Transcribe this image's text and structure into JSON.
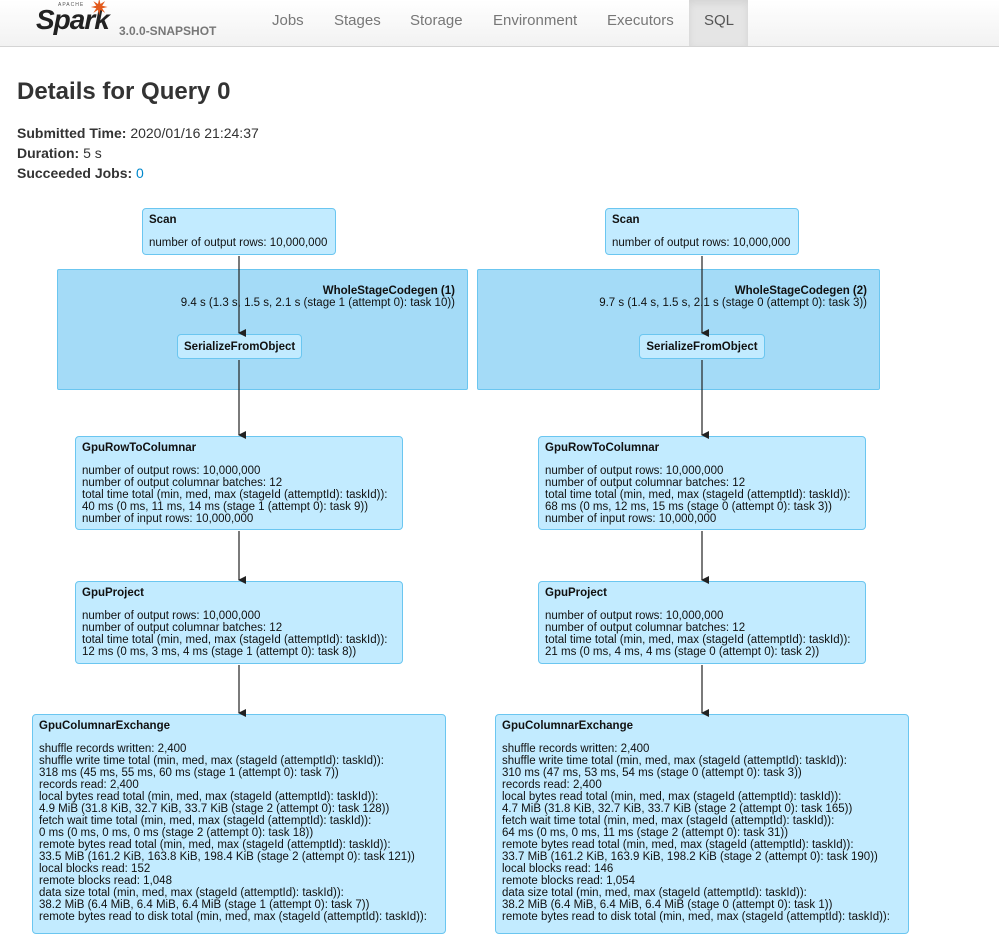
{
  "navbar": {
    "brand_apache": "APACHE",
    "brand_name": "Spark",
    "version": "3.0.0-SNAPSHOT",
    "tabs": [
      {
        "label": "Jobs"
      },
      {
        "label": "Stages"
      },
      {
        "label": "Storage"
      },
      {
        "label": "Environment"
      },
      {
        "label": "Executors"
      },
      {
        "label": "SQL",
        "active": true
      }
    ]
  },
  "page": {
    "title": "Details for Query 0",
    "submitted_label": "Submitted Time:",
    "submitted_value": "2020/01/16 21:24:37",
    "duration_label": "Duration:",
    "duration_value": "5 s",
    "jobs_label": "Succeeded Jobs:",
    "jobs_value": "0"
  },
  "colors": {
    "cluster_fill": "#a4dbf7",
    "node_fill": "#c2ebff",
    "node_border": "#6bc6f0",
    "accent_star": "#e25a1c",
    "link": "#0088cc"
  },
  "plan": {
    "left": {
      "scan": {
        "title": "Scan",
        "metrics": [
          "number of output rows: 10,000,000"
        ]
      },
      "codegen": {
        "title": "WholeStageCodegen (1)",
        "metric": "9.4 s (1.3 s, 1.5 s, 2.1 s (stage 1 (attempt 0): task 10))"
      },
      "serialize": {
        "title": "SerializeFromObject"
      },
      "row_to_columnar": {
        "title": "GpuRowToColumnar",
        "metrics": [
          "number of output rows: 10,000,000",
          "number of output columnar batches: 12",
          "total time total (min, med, max (stageId (attemptId): taskId)):",
          "40 ms (0 ms, 11 ms, 14 ms (stage 1 (attempt 0): task 9))",
          "number of input rows: 10,000,000"
        ]
      },
      "project": {
        "title": "GpuProject",
        "metrics": [
          "number of output rows: 10,000,000",
          "number of output columnar batches: 12",
          "total time total (min, med, max (stageId (attemptId): taskId)):",
          "12 ms (0 ms, 3 ms, 4 ms (stage 1 (attempt 0): task 8))"
        ]
      },
      "exchange": {
        "title": "GpuColumnarExchange",
        "metrics": [
          "shuffle records written: 2,400",
          "shuffle write time total (min, med, max (stageId (attemptId): taskId)):",
          "318 ms (45 ms, 55 ms, 60 ms (stage 1 (attempt 0): task 7))",
          "records read: 2,400",
          "local bytes read total (min, med, max (stageId (attemptId): taskId)):",
          "4.9 MiB (31.8 KiB, 32.7 KiB, 33.7 KiB (stage 2 (attempt 0): task 128))",
          "fetch wait time total (min, med, max (stageId (attemptId): taskId)):",
          "0 ms (0 ms, 0 ms, 0 ms (stage 2 (attempt 0): task 18))",
          "remote bytes read total (min, med, max (stageId (attemptId): taskId)):",
          "33.5 MiB (161.2 KiB, 163.8 KiB, 198.4 KiB (stage 2 (attempt 0): task 121))",
          "local blocks read: 152",
          "remote blocks read: 1,048",
          "data size total (min, med, max (stageId (attemptId): taskId)):",
          "38.2 MiB (6.4 MiB, 6.4 MiB, 6.4 MiB (stage 1 (attempt 0): task 7))",
          "remote bytes read to disk total (min, med, max (stageId (attemptId): taskId)):"
        ]
      }
    },
    "right": {
      "scan": {
        "title": "Scan",
        "metrics": [
          "number of output rows: 10,000,000"
        ]
      },
      "codegen": {
        "title": "WholeStageCodegen (2)",
        "metric": "9.7 s (1.4 s, 1.5 s, 2.1 s (stage 0 (attempt 0): task 3))"
      },
      "serialize": {
        "title": "SerializeFromObject"
      },
      "row_to_columnar": {
        "title": "GpuRowToColumnar",
        "metrics": [
          "number of output rows: 10,000,000",
          "number of output columnar batches: 12",
          "total time total (min, med, max (stageId (attemptId): taskId)):",
          "68 ms (0 ms, 12 ms, 15 ms (stage 0 (attempt 0): task 3))",
          "number of input rows: 10,000,000"
        ]
      },
      "project": {
        "title": "GpuProject",
        "metrics": [
          "number of output rows: 10,000,000",
          "number of output columnar batches: 12",
          "total time total (min, med, max (stageId (attemptId): taskId)):",
          "21 ms (0 ms, 4 ms, 4 ms (stage 0 (attempt 0): task 2))"
        ]
      },
      "exchange": {
        "title": "GpuColumnarExchange",
        "metrics": [
          "shuffle records written: 2,400",
          "shuffle write time total (min, med, max (stageId (attemptId): taskId)):",
          "310 ms (47 ms, 53 ms, 54 ms (stage 0 (attempt 0): task 3))",
          "records read: 2,400",
          "local bytes read total (min, med, max (stageId (attemptId): taskId)):",
          "4.7 MiB (31.8 KiB, 32.7 KiB, 33.7 KiB (stage 2 (attempt 0): task 165))",
          "fetch wait time total (min, med, max (stageId (attemptId): taskId)):",
          "64 ms (0 ms, 0 ms, 11 ms (stage 2 (attempt 0): task 31))",
          "remote bytes read total (min, med, max (stageId (attemptId): taskId)):",
          "33.7 MiB (161.2 KiB, 163.9 KiB, 198.2 KiB (stage 2 (attempt 0): task 190))",
          "local blocks read: 146",
          "remote blocks read: 1,054",
          "data size total (min, med, max (stageId (attemptId): taskId)):",
          "38.2 MiB (6.4 MiB, 6.4 MiB, 6.4 MiB (stage 0 (attempt 0): task 1))",
          "remote bytes read to disk total (min, med, max (stageId (attemptId): taskId)):"
        ]
      }
    }
  }
}
